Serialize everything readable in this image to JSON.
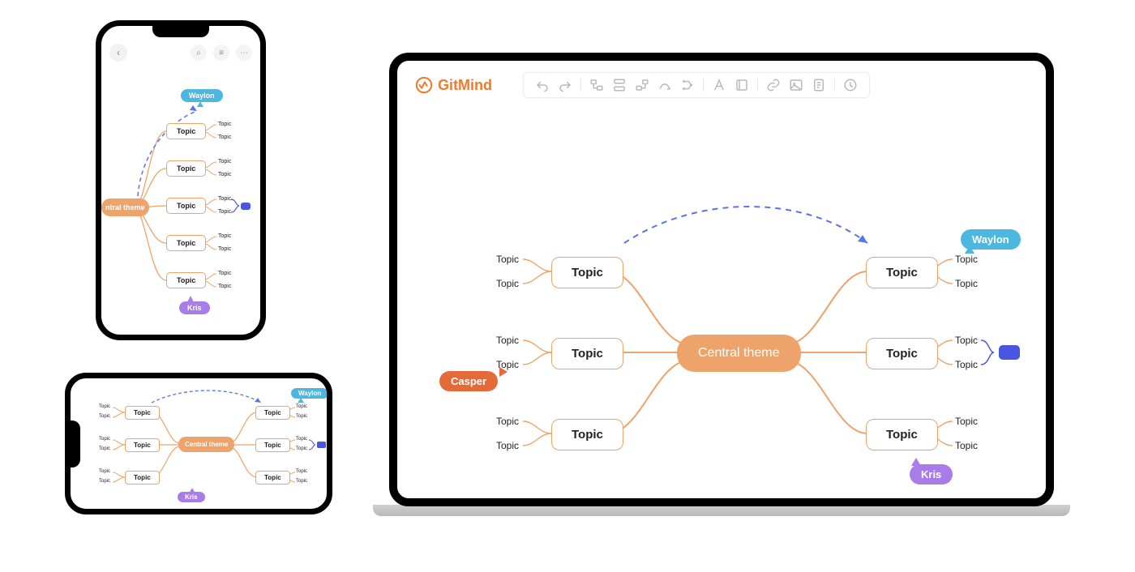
{
  "app": {
    "name": "GitMind"
  },
  "toolbar": {
    "icons": [
      "undo",
      "redo",
      "sep",
      "subtopic",
      "sibling",
      "parent",
      "relation",
      "layout",
      "sep",
      "format",
      "outline",
      "sep",
      "link",
      "image",
      "note",
      "sep",
      "share"
    ]
  },
  "mindmap": {
    "central": "Central  theme",
    "topic": "Topic",
    "subtopic": "Topic"
  },
  "tags": {
    "waylon": "Waylon",
    "kris": "Kris",
    "casper": "Casper"
  },
  "mobile": {
    "central_short": "ntral theme",
    "topic": "Topic",
    "subtopic": "Topic"
  },
  "colors": {
    "accent": "#eea36a",
    "stroke": "#eea36a",
    "waylon": "#4db7df",
    "kris": "#a87de9",
    "casper": "#e46a3a",
    "indicator": "#4a55e0",
    "arrow": "#5a73e8"
  }
}
